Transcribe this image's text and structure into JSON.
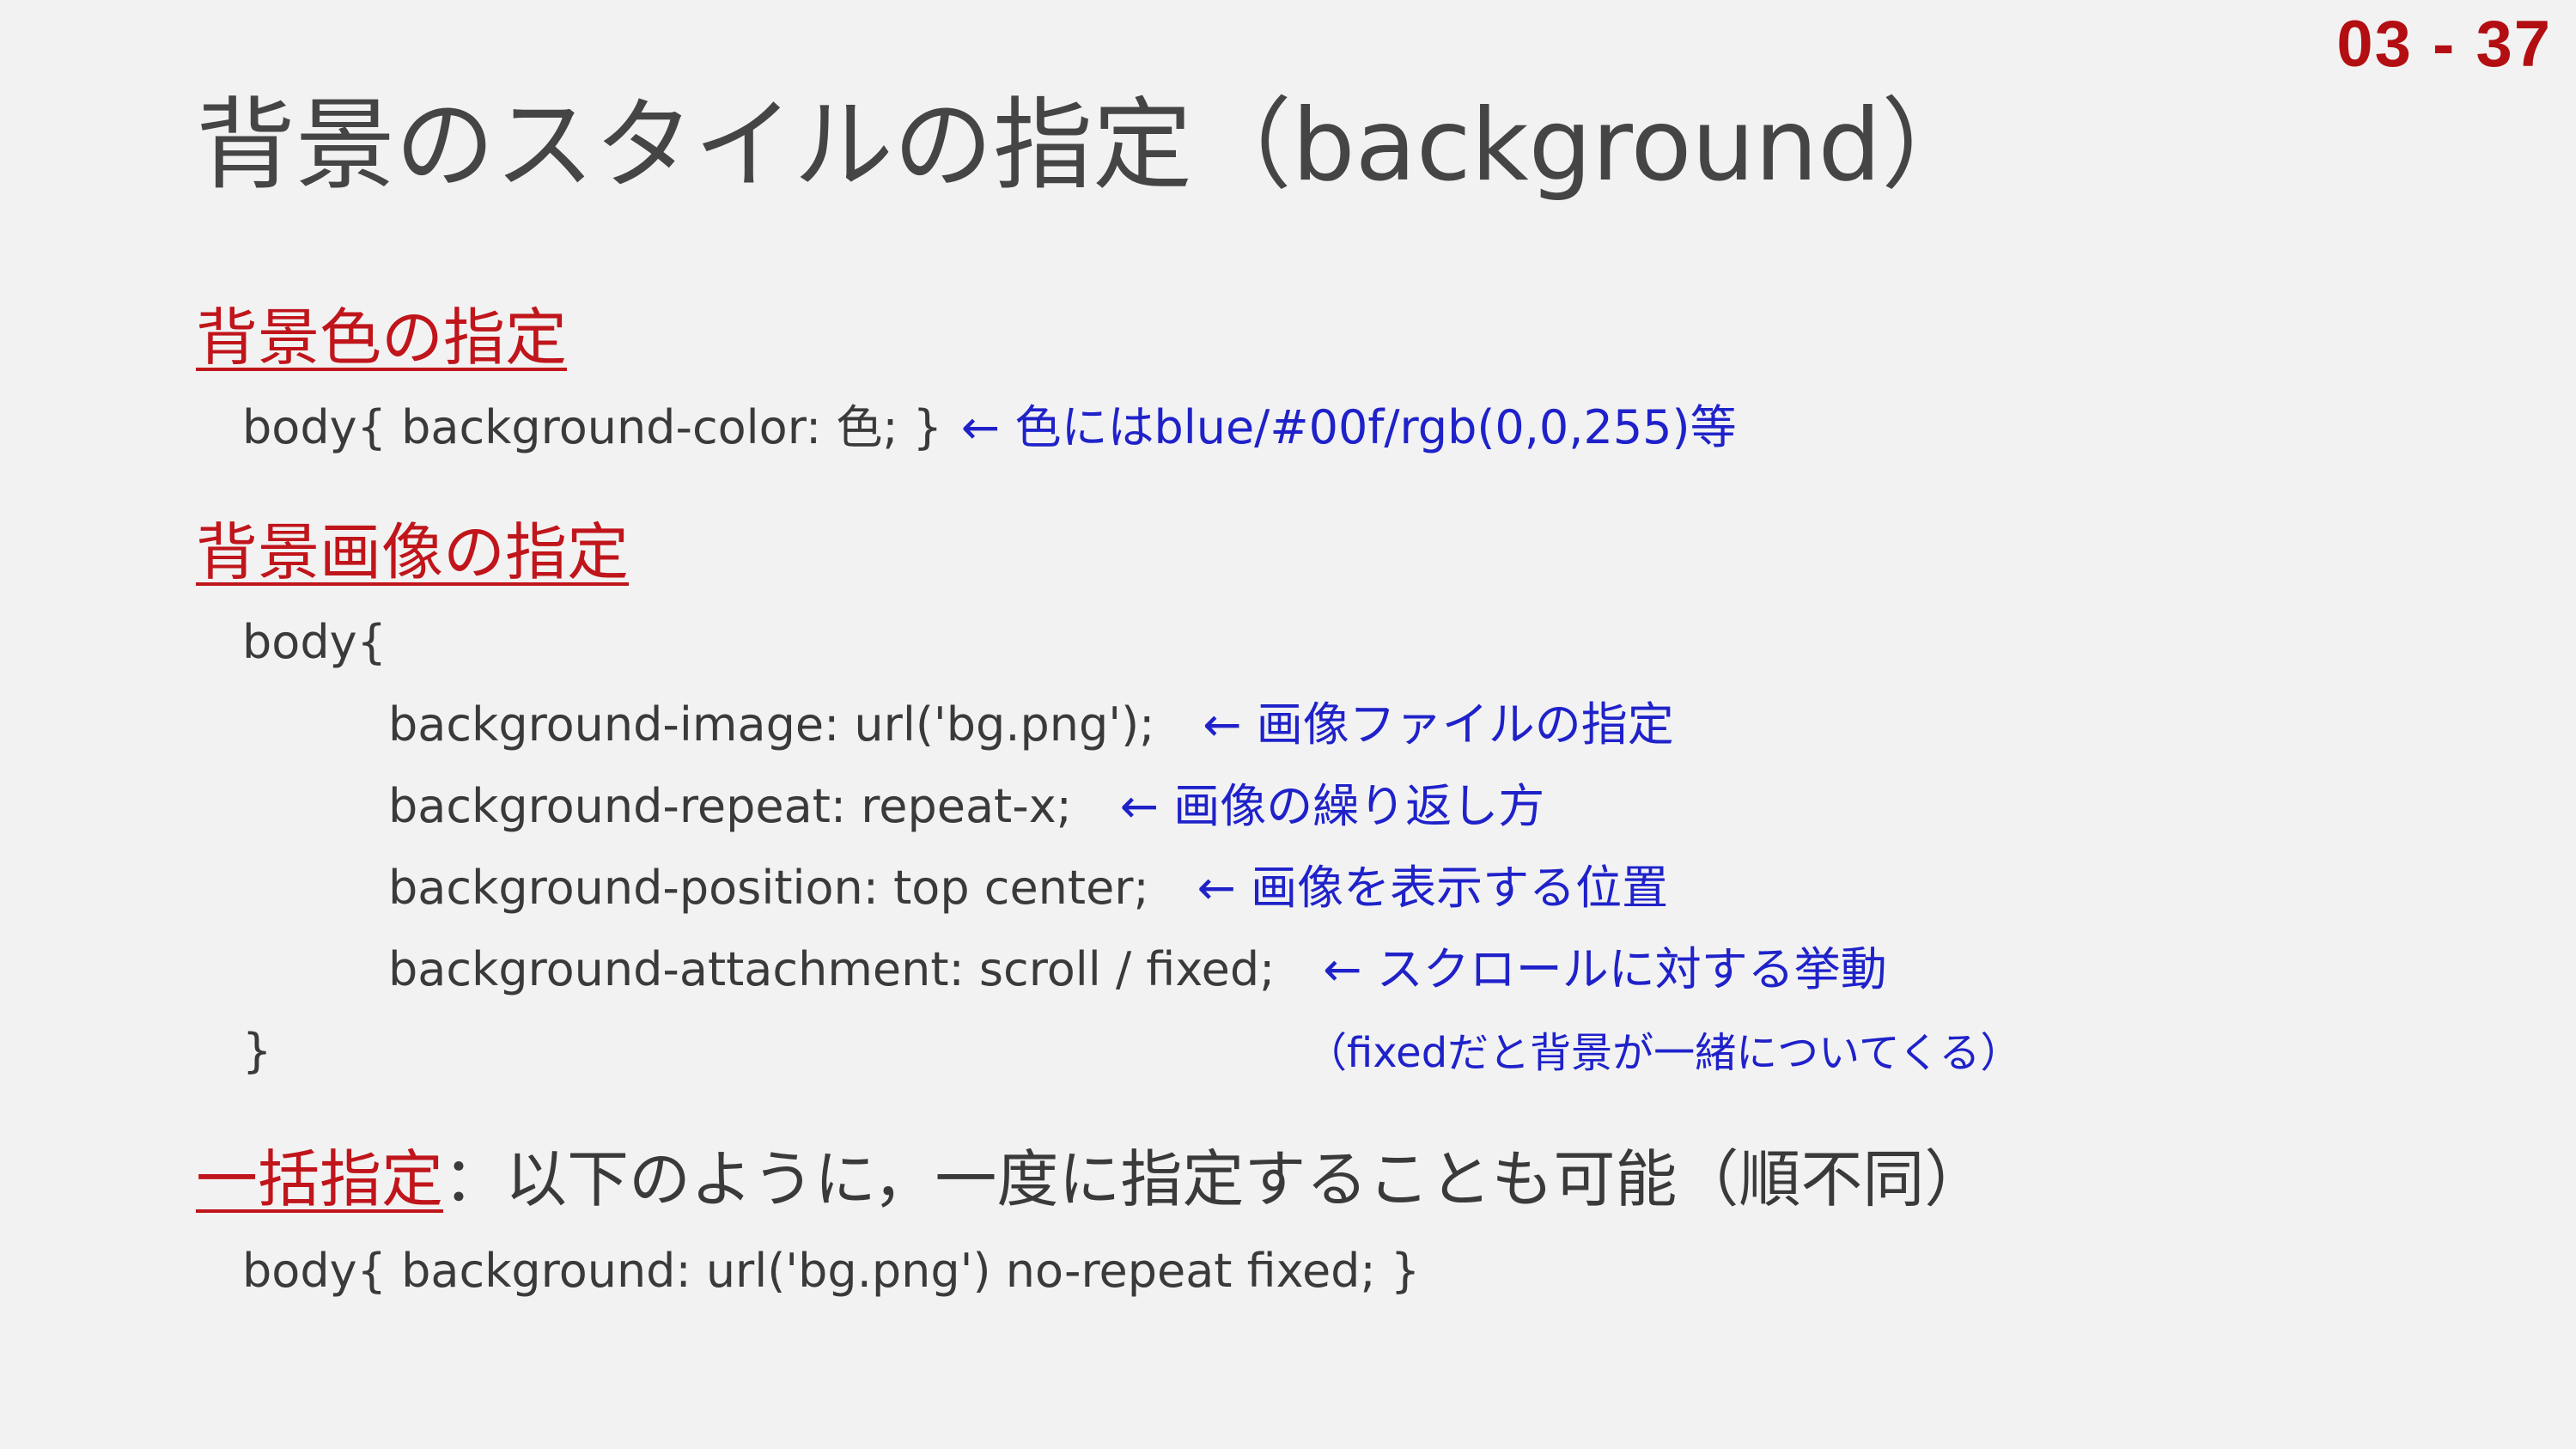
{
  "page_number": "03 - 37",
  "title": "背景のスタイルの指定（background）",
  "sections": {
    "bg_color": {
      "heading": "背景色の指定",
      "code": "body{ background-color: 色; }",
      "note": "← 色にはblue/#00f/rgb(0,0,255)等"
    },
    "bg_image": {
      "heading": "背景画像の指定",
      "open": "body{",
      "lines": [
        {
          "code": "background-image: url('bg.png');",
          "note": "←  画像ファイルの指定"
        },
        {
          "code": "background-repeat: repeat-x;",
          "note": "←  画像の繰り返し方"
        },
        {
          "code": "background-position: top center;",
          "note": "←  画像を表示する位置"
        },
        {
          "code": "background-attachment: scroll / fixed;",
          "note": "←  スクロールに対する挙動"
        }
      ],
      "close": "}",
      "sub_note": "（fixedだと背景が一緒についてくる）"
    },
    "shorthand": {
      "heading": "一括指定",
      "heading_rest": "：以下のように，一度に指定することも可能（順不同）",
      "code": "body{ background: url('bg.png') no-repeat fixed; }"
    }
  }
}
